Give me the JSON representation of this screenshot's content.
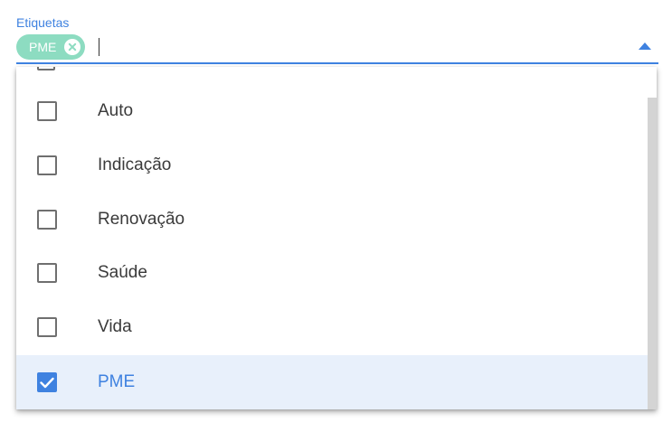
{
  "field": {
    "label": "Etiquetas",
    "chips": [
      {
        "label": "PME",
        "color": "#8ddcc1",
        "close_icon": "close-circle-icon"
      }
    ],
    "dropdown_icon": "caret-up-icon",
    "accent_color": "#3f82e0"
  },
  "menu": {
    "options": [
      {
        "label": "Auto",
        "checked": false
      },
      {
        "label": "Indicação",
        "checked": false
      },
      {
        "label": "Renovação",
        "checked": false
      },
      {
        "label": "Saúde",
        "checked": false
      },
      {
        "label": "Vida",
        "checked": false
      },
      {
        "label": "PME",
        "checked": true
      }
    ],
    "selected_background": "#e8f0fb",
    "check_icon": "checkmark-icon"
  }
}
